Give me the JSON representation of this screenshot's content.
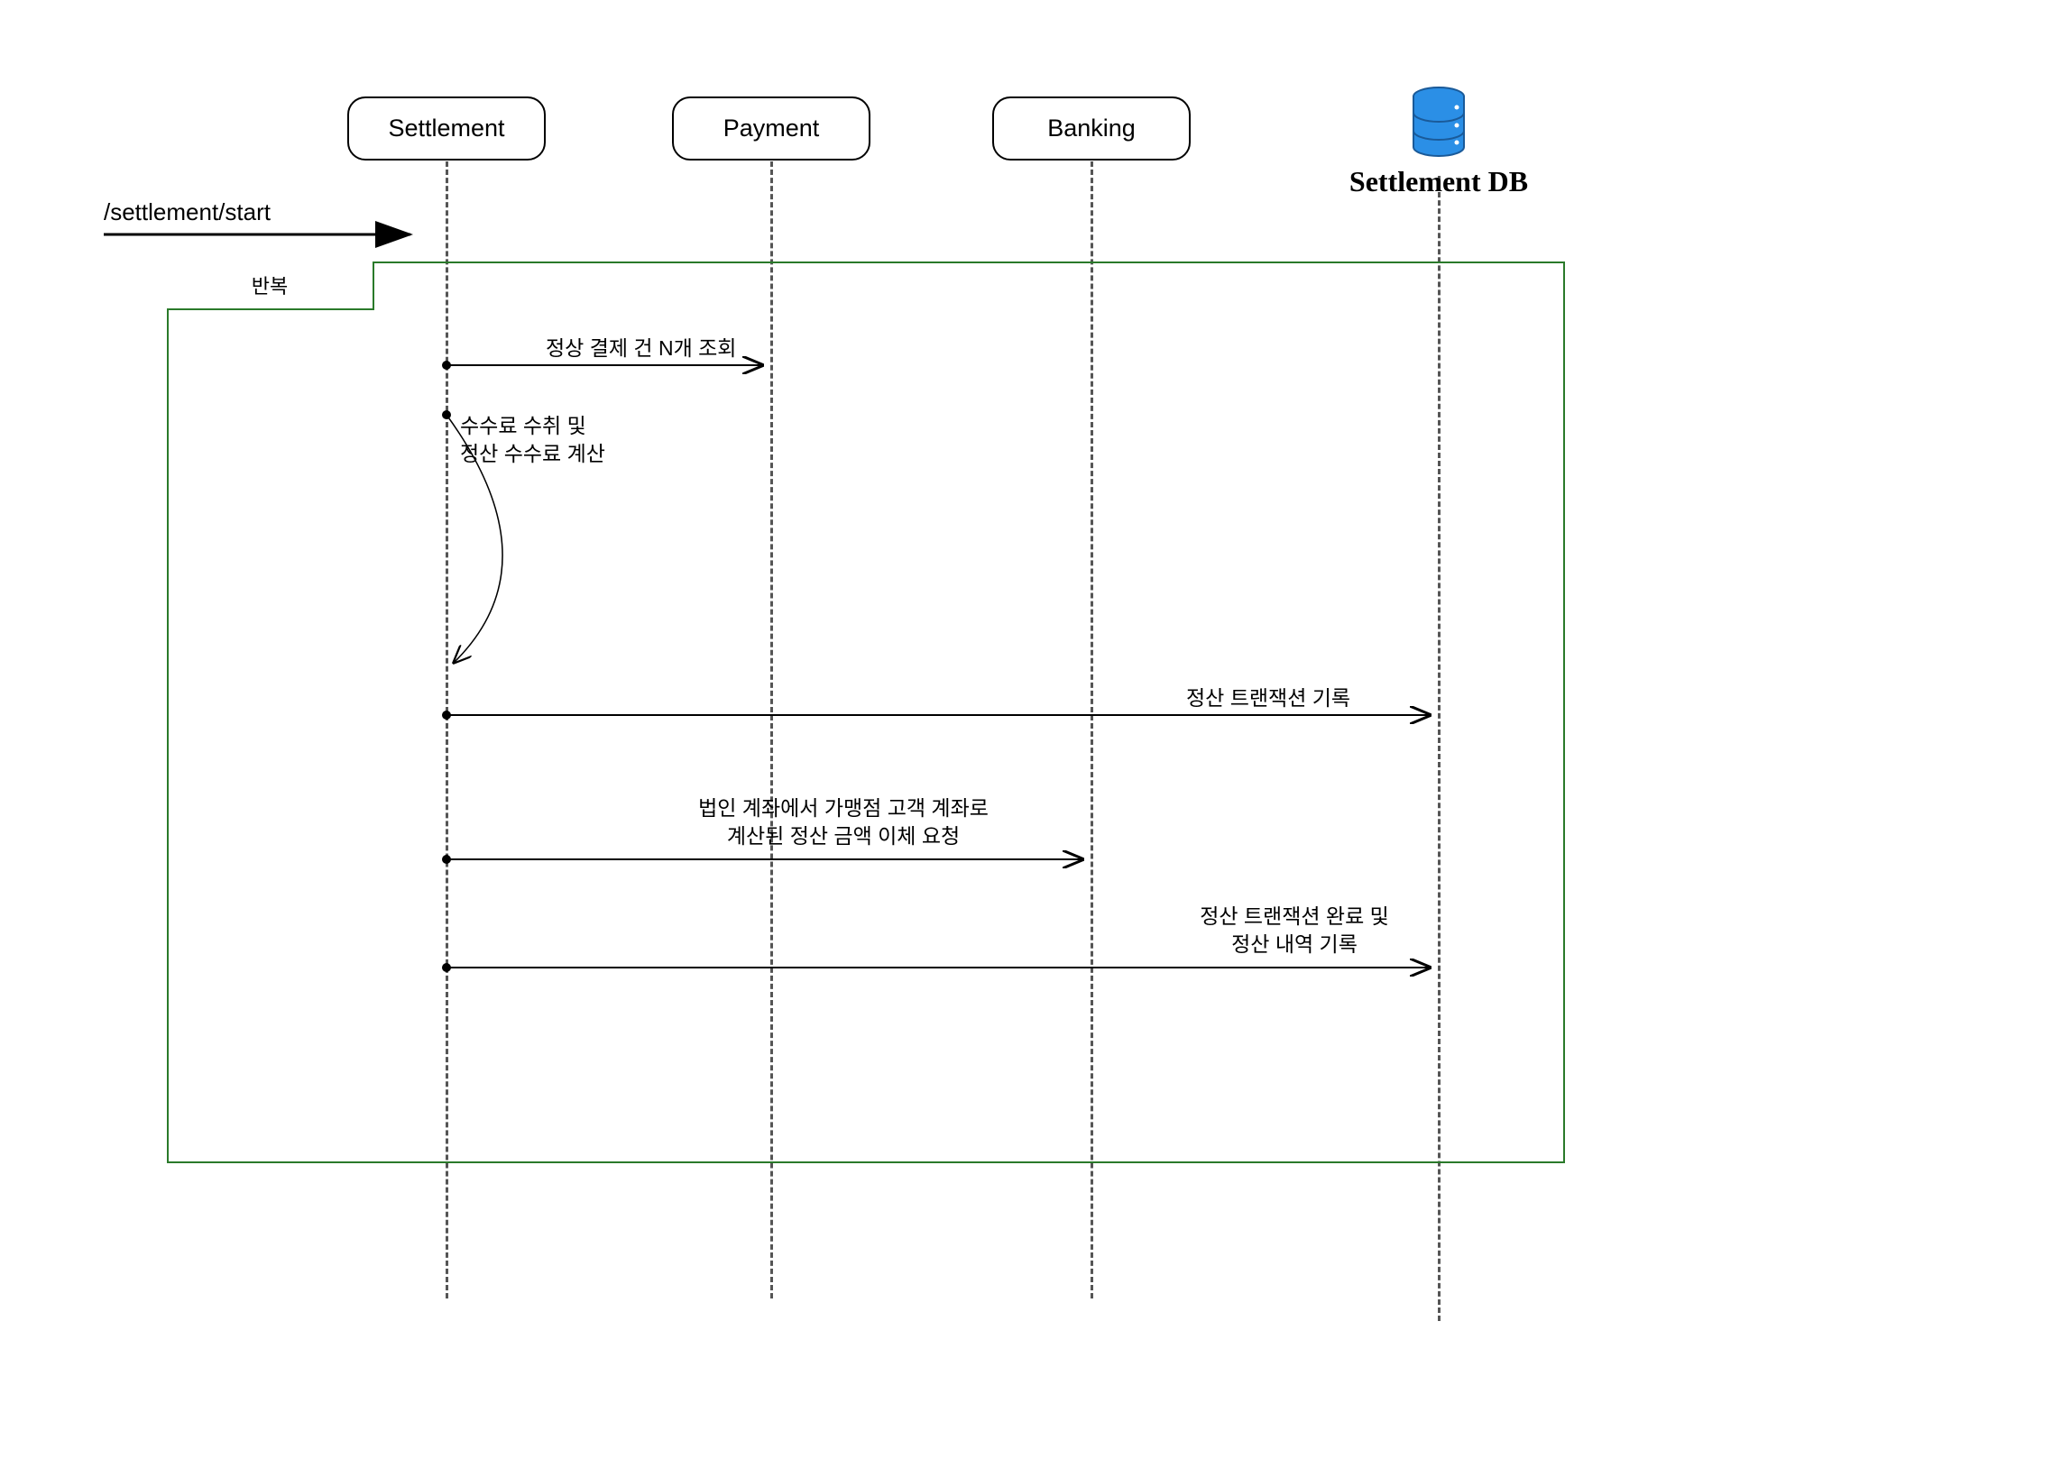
{
  "participants": {
    "settlement": "Settlement",
    "payment": "Payment",
    "banking": "Banking",
    "db_label": "Settlement DB"
  },
  "trigger": "/settlement/start",
  "loop_label": "반복",
  "messages": {
    "m1": "정상 결제 건 N개 조회",
    "m2": "수수료 수취 및\n정산 수수료 계산",
    "m3": "정산 트랜잭션 기록",
    "m4": "법인 계좌에서 가맹점 고객 계좌로\n계산된 정산 금액 이체 요청",
    "m5": "정산 트랜잭션 완료 및\n정산 내역 기록"
  }
}
